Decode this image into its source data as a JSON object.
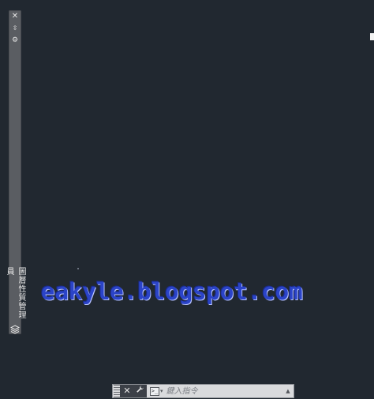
{
  "palette": {
    "title": "圖層性質管理員",
    "close_glyph": "✕",
    "autohide_glyph": "⇳",
    "props_glyph": "⚙"
  },
  "watermark": {
    "text": "eakyle.blogspot.com"
  },
  "command_line": {
    "close_glyph": "✕",
    "customize_glyph": "🔧",
    "prompt_glyph": ">_",
    "prompt_caret": "▾",
    "placeholder": "鍵入指令",
    "history_glyph": "▲"
  },
  "colors": {
    "canvas_background": "#212830",
    "palette_background": "#5a5d62",
    "watermark": "#2b44c8",
    "command_bar": "#d9dadc"
  }
}
